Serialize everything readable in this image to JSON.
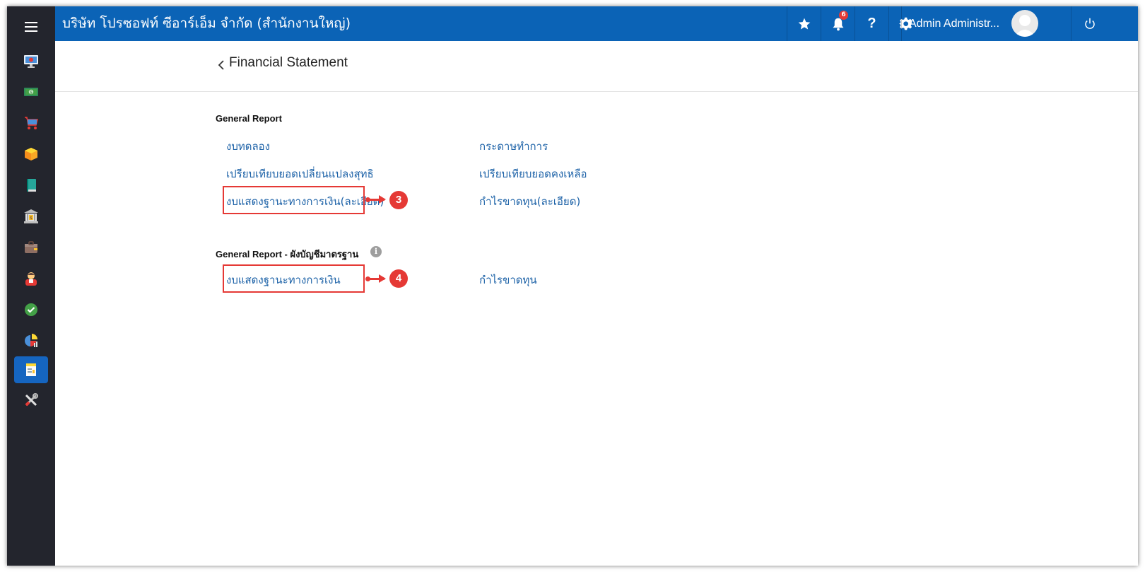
{
  "company": "บริษัท โปรซอฟท์ ซีอาร์เอ็ม จำกัด (สำนักงานใหญ่)",
  "notifications": {
    "count": "6"
  },
  "help_label": "?",
  "user": {
    "name": "Admin Administr..."
  },
  "page": {
    "title": "Financial Statement"
  },
  "sidebar": {
    "icons": [
      "dashboard-icon",
      "money-icon",
      "cart-icon",
      "box-icon",
      "book-icon",
      "bank-icon",
      "wallet-icon",
      "person-icon",
      "check-icon",
      "pie-chart-icon",
      "report-icon",
      "tools-icon"
    ],
    "active_index": 10
  },
  "general_report": {
    "title": "General Report",
    "left": [
      "งบทดลอง",
      "เปรียบเทียบยอดเปลี่ยนแปลงสุทธิ",
      "งบแสดงฐานะทางการเงิน(ละเอียด)"
    ],
    "right": [
      "กระดาษทำการ",
      "เปรียบเทียบยอดคงเหลือ",
      "กำไรขาดทุน(ละเอียด)"
    ]
  },
  "standard_report": {
    "title": "General Report - ผังบัญชีมาตรฐาน",
    "info": "i",
    "left": [
      "งบแสดงฐานะทางการเงิน"
    ],
    "right": [
      "กำไรขาดทุน"
    ]
  },
  "annotations": {
    "step3": "3",
    "step4": "4"
  },
  "colors": {
    "topbar": "#0b63b6",
    "sidebar": "#23252d",
    "link": "#1e63a8",
    "highlight": "#e53935"
  }
}
